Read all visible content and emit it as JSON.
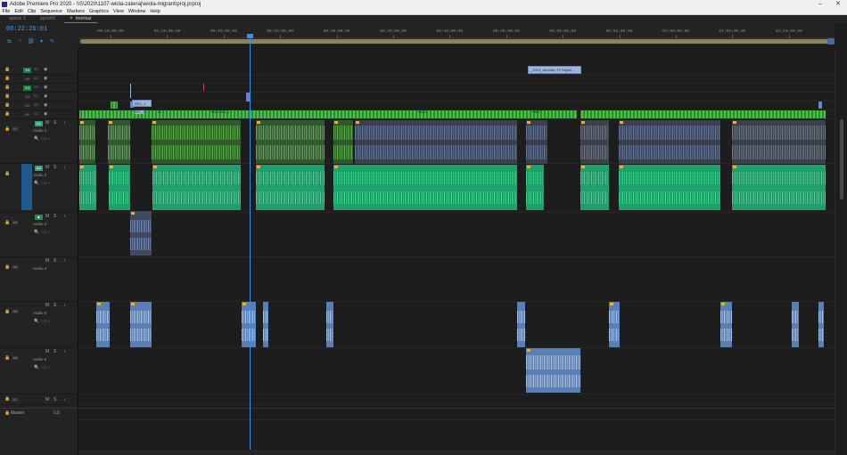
{
  "window": {
    "title": "Adobe Premiere Pro 2020 - \\\\S\\2020\\1107-wiola-zalenaj\\wiola-migrant\\proj.prproj",
    "min": "–",
    "close": "✕"
  },
  "menu": [
    "File",
    "Edit",
    "Clip",
    "Sequence",
    "Markers",
    "Graphics",
    "View",
    "Window",
    "Help"
  ],
  "seq_tabs": [
    {
      "label": "synch 2",
      "active": false
    },
    {
      "label": "synch1",
      "active": false
    },
    {
      "label": "montaż",
      "active": true,
      "close": "×"
    }
  ],
  "timecode": "00:22:26:01",
  "tools": [
    "ripple-icon",
    "snap-icon",
    "linked-icon",
    "marker-icon",
    "wrench-icon"
  ],
  "ruler_ticks": [
    "00;10;00;00",
    "00;15;00;00",
    "00;20;00;00",
    "00;25;00;00",
    "00;30;00;00",
    "00;35;00;00",
    "00;40;00;00",
    "00;45;00;00",
    "00;50;00;00",
    "00;55;00;00",
    "01;00;00;00",
    "01;05;00;00",
    "01;10;00;00"
  ],
  "video_tracks": [
    {
      "name": "V6"
    },
    {
      "name": "V5"
    },
    {
      "name": "V4"
    },
    {
      "name": "V3"
    },
    {
      "name": "V2"
    },
    {
      "name": "V1"
    }
  ],
  "audio_tracks": [
    {
      "name": "A1",
      "label": "Audio 1",
      "src": "A1"
    },
    {
      "name": "A2",
      "label": "Audio 2",
      "src": "A2"
    },
    {
      "name": "A3",
      "label": "Audio 3"
    },
    {
      "name": "A4",
      "label": "Audio 4"
    },
    {
      "name": "A5",
      "label": "Audio 5"
    },
    {
      "name": "A6",
      "label": "Audio 6"
    },
    {
      "name": "A7",
      "label": ""
    }
  ],
  "track_btns": {
    "m": "M",
    "s": "S",
    "mic": "🎙",
    "eye": "👁",
    "lock": "🔒",
    "film": "▭"
  },
  "mix": {
    "label": "Master",
    "value": "0.0"
  },
  "clips": {
    "title_v5": "_2019_Amarillo_Pr Digital ...",
    "v2_a": "REC_1",
    "v1_labels": [
      "REC_1",
      "CL",
      "REC2-513_1",
      "REC2",
      "PART"
    ]
  }
}
